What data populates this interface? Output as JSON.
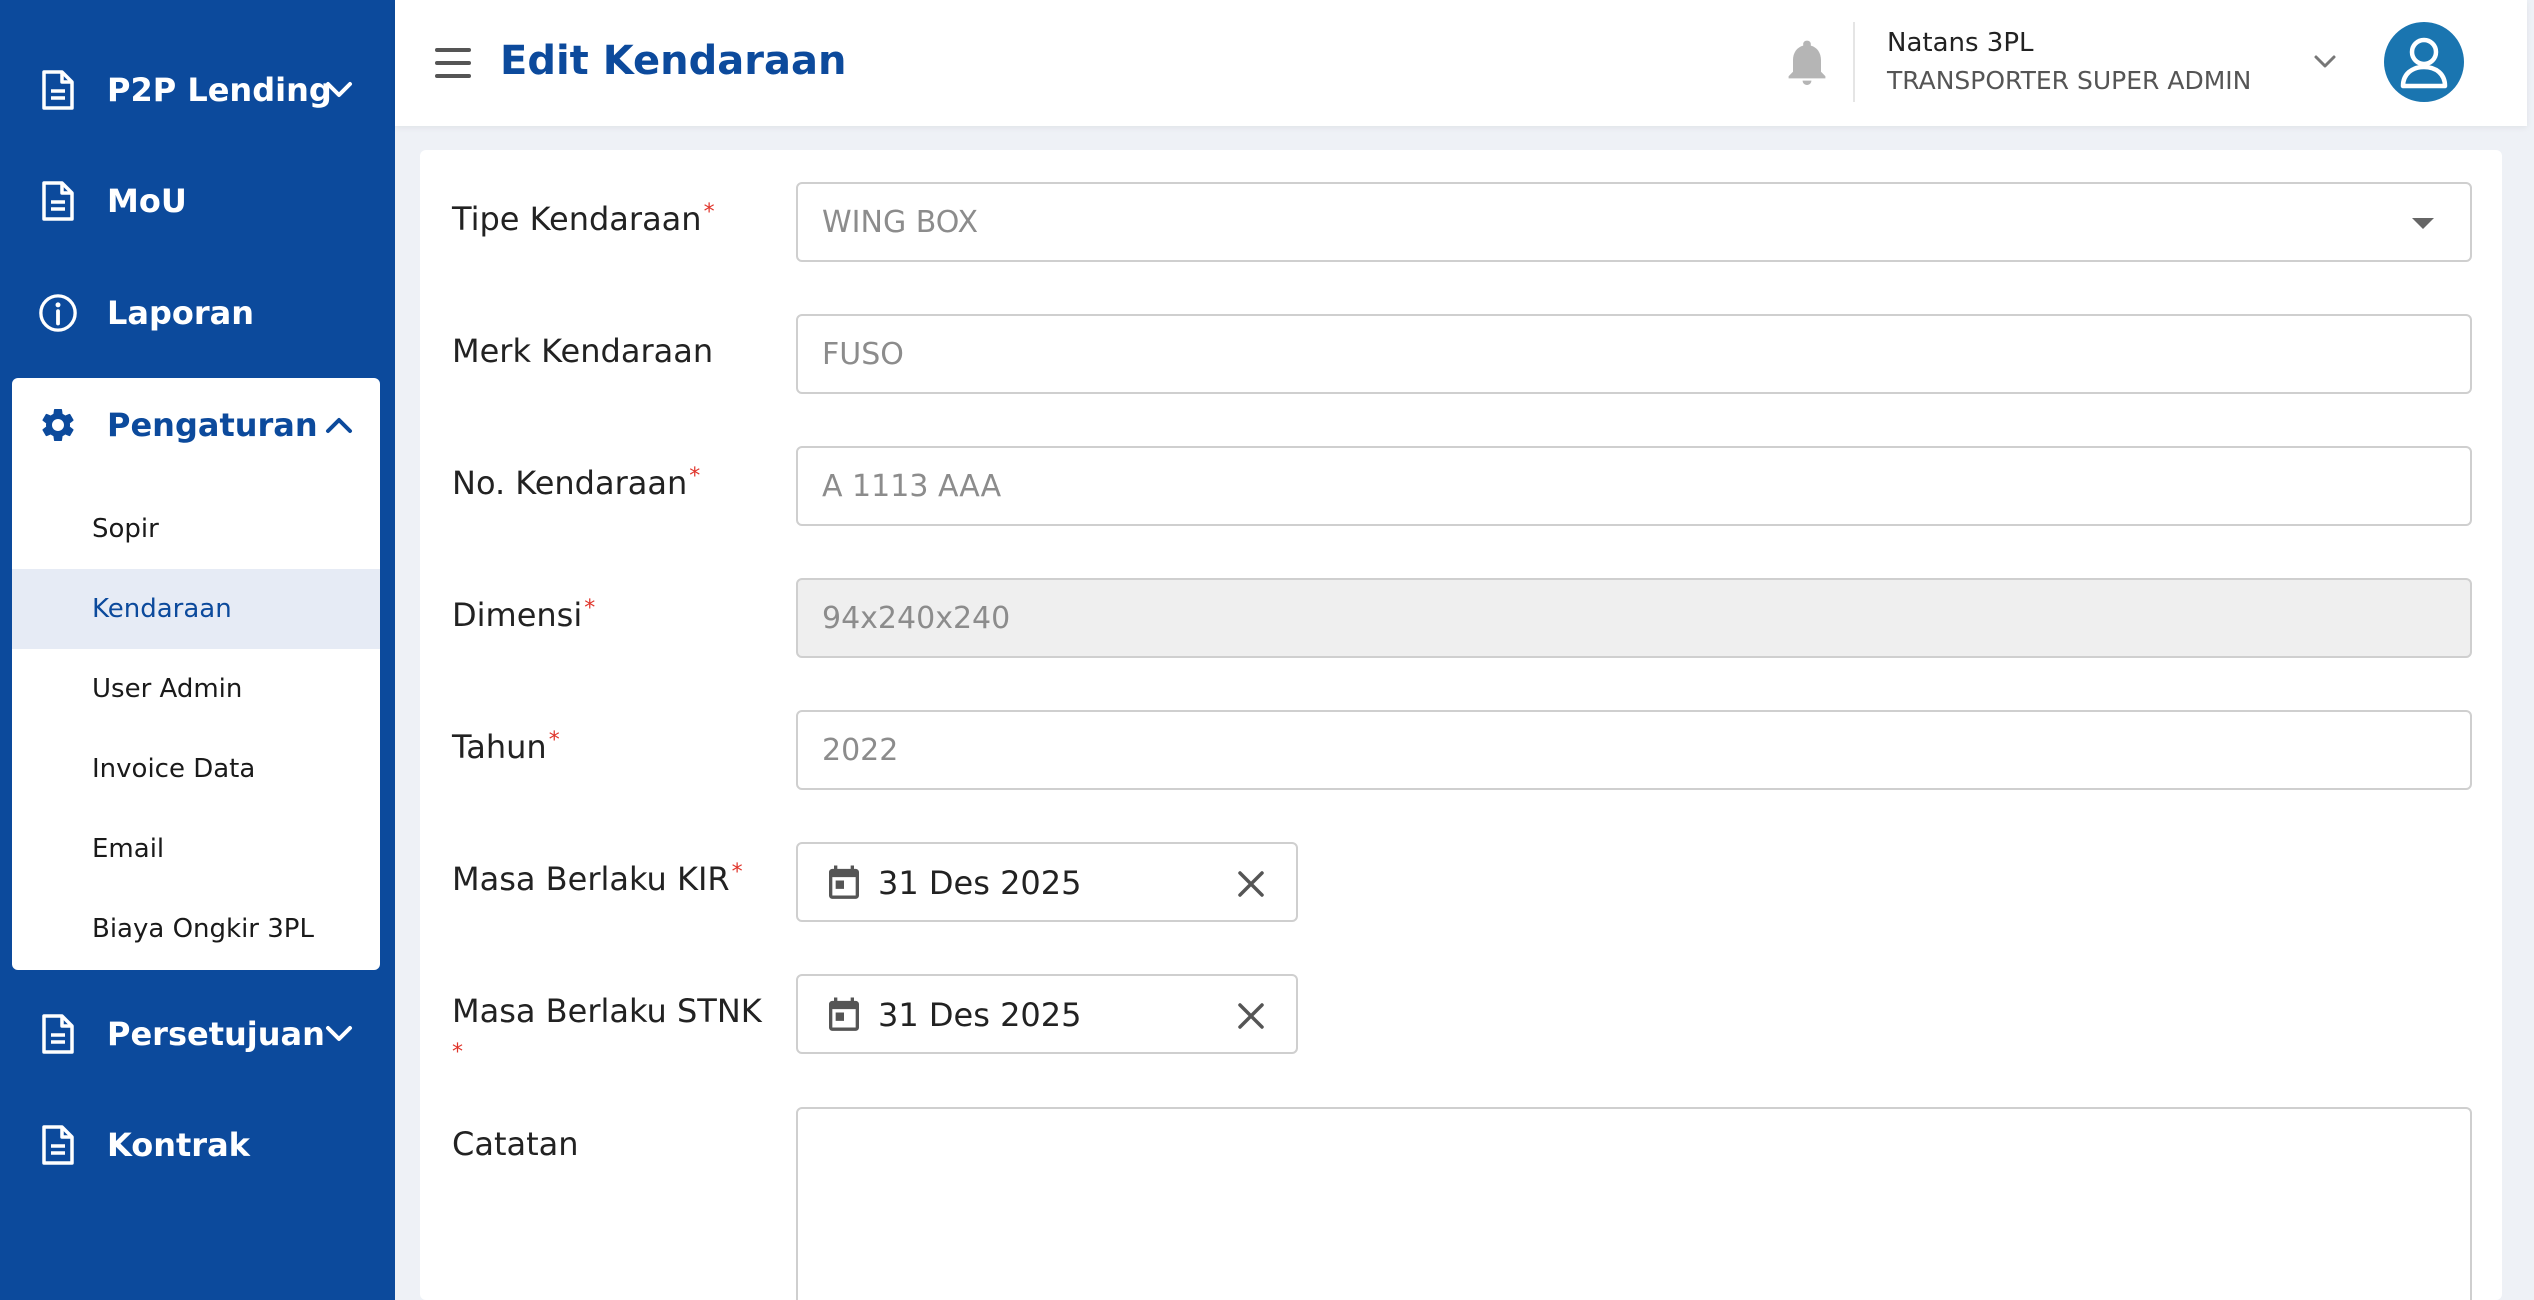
{
  "sidebar": {
    "items": [
      {
        "label": "P2P Lending",
        "icon": "document-icon"
      },
      {
        "label": "MoU",
        "icon": "document-icon"
      },
      {
        "label": "Laporan",
        "icon": "info-icon"
      },
      {
        "label": "Pengaturan",
        "icon": "gear-icon",
        "expanded": true
      },
      {
        "label": "Persetujuan",
        "icon": "document-icon"
      },
      {
        "label": "Kontrak",
        "icon": "document-icon"
      }
    ],
    "submenu": [
      {
        "label": "Sopir"
      },
      {
        "label": "Kendaraan",
        "active": true
      },
      {
        "label": "User Admin"
      },
      {
        "label": "Invoice Data"
      },
      {
        "label": "Email"
      },
      {
        "label": "Biaya Ongkir 3PL"
      }
    ]
  },
  "header": {
    "title": "Edit Kendaraan",
    "user_name": "Natans 3PL",
    "user_role": "TRANSPORTER SUPER ADMIN"
  },
  "form": {
    "tipe": {
      "label": "Tipe Kendaraan",
      "value": "WING BOX"
    },
    "merk": {
      "label": "Merk Kendaraan",
      "value": "FUSO"
    },
    "no": {
      "label": "No. Kendaraan",
      "value": "A 1113 AAA"
    },
    "dimensi": {
      "label": "Dimensi",
      "value": "94x240x240"
    },
    "tahun": {
      "label": "Tahun",
      "value": "2022"
    },
    "kir": {
      "label": "Masa Berlaku KIR",
      "value": "31 Des 2025"
    },
    "stnk": {
      "label": "Masa Berlaku STNK",
      "value": "31 Des 2025"
    },
    "catatan": {
      "label": "Catatan",
      "value": ""
    },
    "required_mark": "*"
  },
  "colors": {
    "sidebar": "#0c4a9c",
    "accent": "#0c4a9c",
    "required": "#e0352b",
    "avatar": "#1a75b0"
  }
}
